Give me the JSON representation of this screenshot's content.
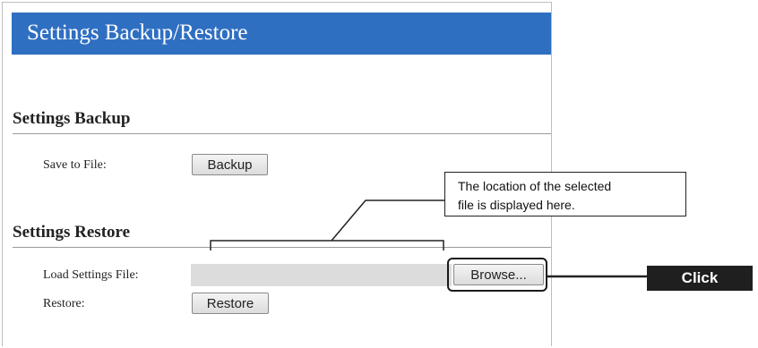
{
  "page": {
    "title": "Settings Backup/Restore"
  },
  "backup_section": {
    "heading": "Settings Backup",
    "save_label": "Save to File:",
    "backup_button": "Backup"
  },
  "restore_section": {
    "heading": "Settings Restore",
    "load_label": "Load Settings File:",
    "file_value": "",
    "browse_button": "Browse...",
    "restore_label": "Restore:",
    "restore_button": "Restore"
  },
  "annotations": {
    "callout_line1": "The location of the selected",
    "callout_line2": "file is displayed here.",
    "click_label": "Click"
  },
  "colors": {
    "title_bar": "#2f6fc2",
    "click_label_bg": "#1f1f1f"
  }
}
